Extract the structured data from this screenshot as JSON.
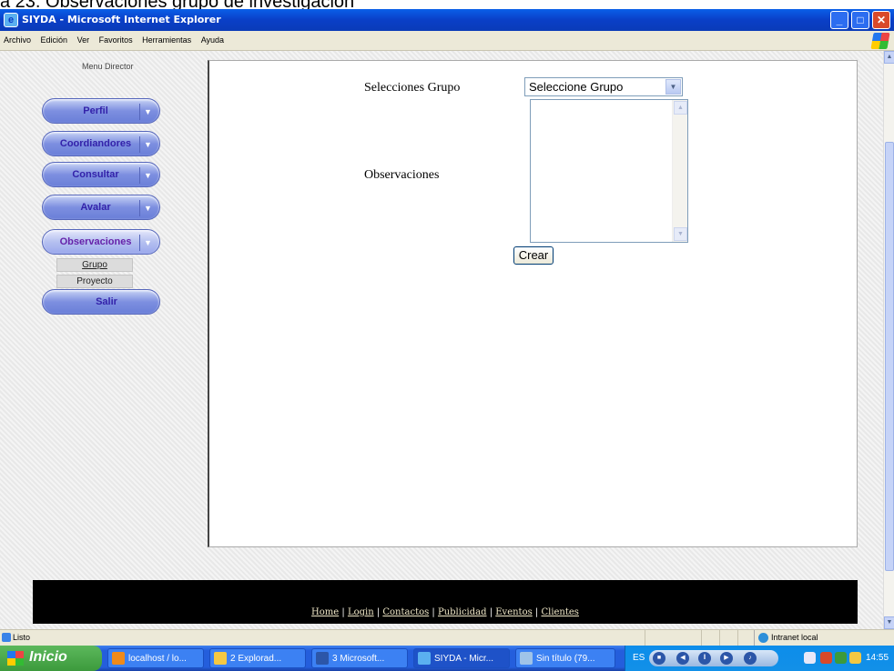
{
  "caption": "a 23. Observaciones grupo de investigación",
  "window": {
    "title": "SIYDA - Microsoft Internet Explorer",
    "buttons": {
      "minimize": "_",
      "maximize": "□",
      "close": "✕"
    }
  },
  "menubar": [
    "Archivo",
    "Edición",
    "Ver",
    "Favoritos",
    "Herramientas",
    "Ayuda"
  ],
  "sidebar": {
    "title": "Menu Director",
    "items": [
      {
        "label": "Perfil"
      },
      {
        "label": "Coordiandores"
      },
      {
        "label": "Consultar"
      },
      {
        "label": "Avalar"
      },
      {
        "label": "Observaciones"
      }
    ],
    "submenu": [
      "Grupo",
      "Proyecto"
    ],
    "exit": "Salir"
  },
  "form": {
    "group_label": "Selecciones Grupo",
    "group_select_value": "Seleccione Grupo",
    "observations_label": "Observaciones",
    "submit": "Crear"
  },
  "footer": {
    "links": [
      "Home",
      "Login",
      "Contactos",
      "Publicidad",
      "Eventos",
      "Clientes"
    ],
    "separator": " | "
  },
  "statusbar": {
    "status": "Listo",
    "zone": "Intranet local"
  },
  "taskbar": {
    "start": "Inicio",
    "tasks": [
      "localhost / lo...",
      "2 Explorad...",
      "3 Microsoft...",
      "SIYDA - Micr...",
      "Sin título (79..."
    ],
    "language": "ES",
    "clock": "14:55"
  },
  "colors": {
    "titlebar": "#0a3fc7",
    "taskbar": "#245edc",
    "start": "#3c9a3c",
    "nav_text": "#3322aa"
  }
}
